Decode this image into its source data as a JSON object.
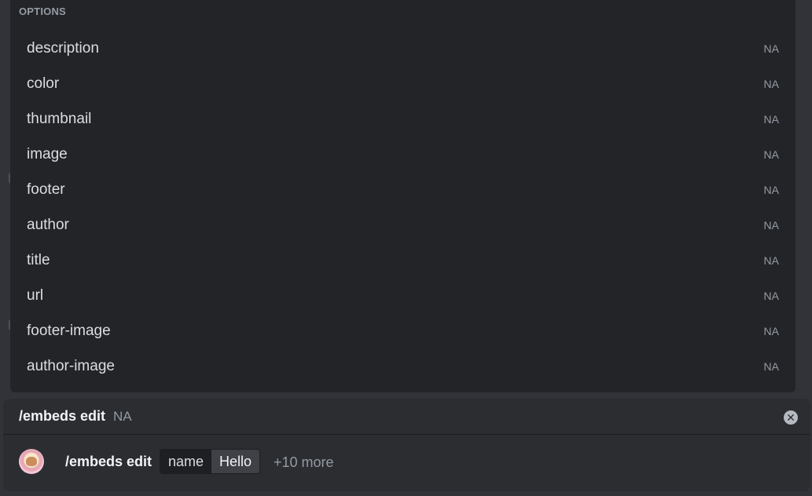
{
  "options": {
    "header": "OPTIONS",
    "items": [
      {
        "name": "description",
        "type": "NA"
      },
      {
        "name": "color",
        "type": "NA"
      },
      {
        "name": "thumbnail",
        "type": "NA"
      },
      {
        "name": "image",
        "type": "NA"
      },
      {
        "name": "footer",
        "type": "NA"
      },
      {
        "name": "author",
        "type": "NA"
      },
      {
        "name": "title",
        "type": "NA"
      },
      {
        "name": "url",
        "type": "NA"
      },
      {
        "name": "footer-image",
        "type": "NA"
      },
      {
        "name": "author-image",
        "type": "NA"
      }
    ]
  },
  "command": {
    "title": "/embeds edit",
    "description": "NA",
    "clear_icon": "close-circle-icon"
  },
  "input": {
    "avatar": "user-avatar",
    "command": "/embeds edit",
    "param_key": "name",
    "param_value": "Hello",
    "more": "+10 more"
  },
  "colors": {
    "background": "#313338",
    "panel": "#232428",
    "command_bar": "#2b2d31",
    "muted_text": "#949ba4",
    "text": "#dbdee1"
  }
}
